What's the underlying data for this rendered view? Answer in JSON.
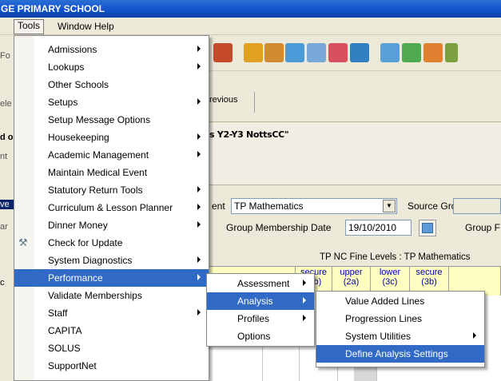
{
  "window": {
    "title": "GE PRIMARY SCHOOL"
  },
  "menubar": {
    "tools": "Tools",
    "window": "Window",
    "help": "Help"
  },
  "left_partial": [
    "Fo",
    "ele",
    "d o",
    "nt",
    "ve",
    "ar",
    "c"
  ],
  "nav": {
    "previous": "revious"
  },
  "info": {
    "title_text": "s Y2-Y3 NottsCC\""
  },
  "form": {
    "element_label": "ent",
    "element_value": "TP Mathematics",
    "source_group_label": "Source Group",
    "membership_date_label": "Group Membership Date",
    "membership_date_value": "19/10/2010",
    "group_f_label": "Group F"
  },
  "grid": {
    "caption": "TP NC Fine Levels : TP Mathematics",
    "headers": [
      {
        "line1": "secure",
        "line2": "(2b)"
      },
      {
        "line1": "upper",
        "line2": "(2a)"
      },
      {
        "line1": "lower",
        "line2": "(3c)"
      },
      {
        "line1": "secure",
        "line2": "(3b)"
      }
    ]
  },
  "tools_menu": [
    {
      "label": "Admissions",
      "submenu": true
    },
    {
      "label": "Lookups",
      "submenu": true
    },
    {
      "label": "Other Schools",
      "submenu": false
    },
    {
      "label": "Setups",
      "submenu": true
    },
    {
      "label": "Setup Message Options",
      "submenu": false
    },
    {
      "label": "Housekeeping",
      "submenu": true
    },
    {
      "label": "Academic Management",
      "submenu": true
    },
    {
      "label": "Maintain Medical Event",
      "submenu": false
    },
    {
      "label": "Statutory Return Tools",
      "submenu": true
    },
    {
      "label": "Curriculum & Lesson Planner",
      "submenu": true
    },
    {
      "label": "Dinner Money",
      "submenu": true
    },
    {
      "label": "Check for Update",
      "submenu": false
    },
    {
      "label": "System Diagnostics",
      "submenu": true
    },
    {
      "label": "Performance",
      "submenu": true
    },
    {
      "label": "Validate Memberships",
      "submenu": false
    },
    {
      "label": "Staff",
      "submenu": true
    },
    {
      "label": "CAPITA",
      "submenu": false
    },
    {
      "label": "SOLUS",
      "submenu": false
    },
    {
      "label": "SupportNet",
      "submenu": false
    }
  ],
  "performance_menu": [
    {
      "label": "Assessment",
      "submenu": true
    },
    {
      "label": "Analysis",
      "submenu": true
    },
    {
      "label": "Profiles",
      "submenu": true
    },
    {
      "label": "Options",
      "submenu": false
    }
  ],
  "analysis_menu": [
    {
      "label": "Value Added Lines",
      "submenu": false
    },
    {
      "label": "Progression Lines",
      "submenu": false
    },
    {
      "label": "System Utilities",
      "submenu": true
    },
    {
      "label": "Define Analysis Settings",
      "submenu": false
    }
  ],
  "colors": {
    "highlight": "#316ac5",
    "titlebar": "#1050c8"
  }
}
